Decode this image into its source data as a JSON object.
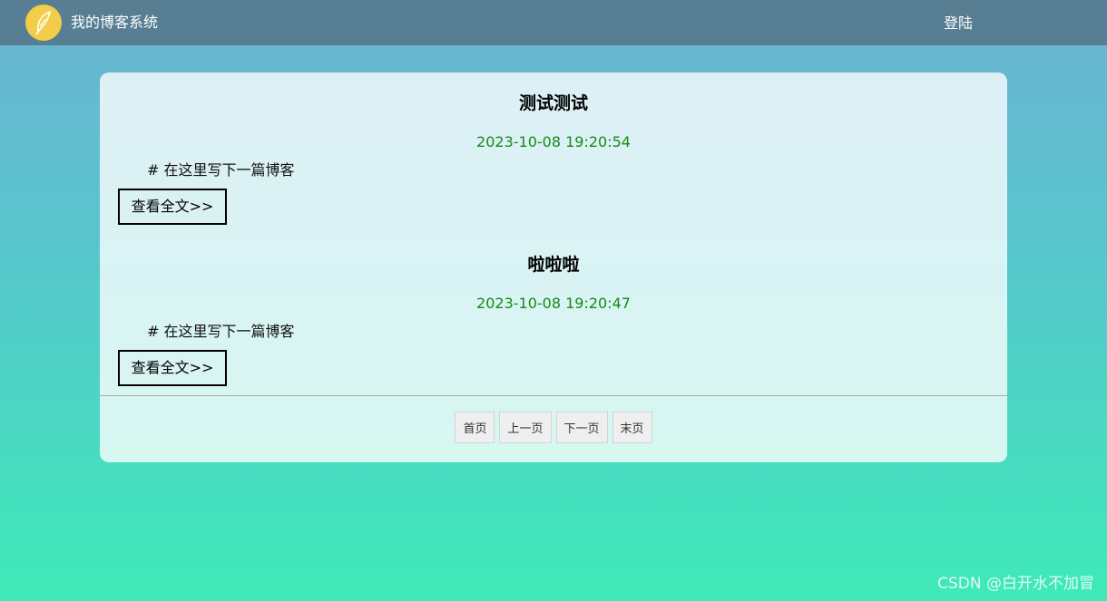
{
  "navbar": {
    "brand": "我的博客系统",
    "login_label": "登陆",
    "logo_icon": "feather-icon",
    "background": "#577e92"
  },
  "blogs": [
    {
      "title": "测试测试",
      "date": "2023-10-08 19:20:54",
      "desc": "# 在这里写下一篇博客",
      "detail_label": "查看全文>>"
    },
    {
      "title": "啦啦啦",
      "date": "2023-10-08 19:20:47",
      "desc": "# 在这里写下一篇博客",
      "detail_label": "查看全文>>"
    }
  ],
  "pager": {
    "first": "首页",
    "prev": "上一页",
    "next": "下一页",
    "last": "末页"
  },
  "watermark": "CSDN @白开水不加冒",
  "colors": {
    "date": "#168a16",
    "logo": "#f2cd4a"
  }
}
